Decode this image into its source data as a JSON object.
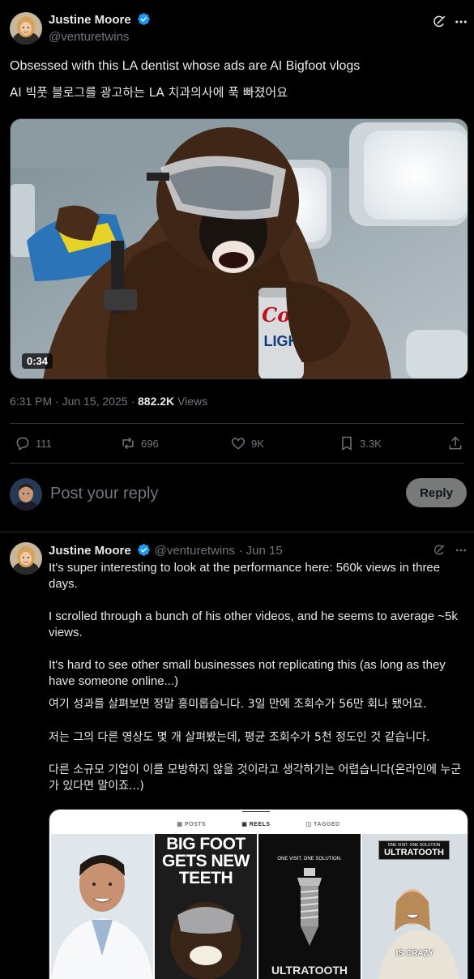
{
  "tweet": {
    "author_name": "Justine Moore",
    "author_handle": "@venturetwins",
    "text_en": "Obsessed with this LA dentist whose ads are AI Bigfoot vlogs",
    "text_ko": "AI 빅풋 블로그를 광고하는 LA 치과의사에 푹 빠졌어요",
    "video_duration": "0:34",
    "can_text": "Cor",
    "can_text2": "LIGH",
    "timestamp": "6:31 PM · Jun 15, 2025",
    "separator": "·",
    "views_count": "882.2K",
    "views_label": "Views",
    "actions": {
      "replies": "111",
      "reposts": "696",
      "likes": "9K",
      "bookmarks": "3.3K"
    }
  },
  "composer": {
    "placeholder": "Post your reply",
    "reply_button": "Reply"
  },
  "reply": {
    "author_name": "Justine Moore",
    "author_handle": "@venturetwins",
    "date": "· Jun 15",
    "para1": "It's super interesting to look at the performance here: 560k views in three days.",
    "para2": "I scrolled through a bunch of his other videos, and he seems to average ~5k views.",
    "para3": "It's hard to see other small businesses not replicating this (as long as they have someone online...)",
    "ko1": "여기 성과를 살펴보면 정말 흥미롭습니다. 3일 만에 조회수가 56만 회나 됐어요.",
    "ko2": "저는 그의 다른 영상도 몇 개 살펴봤는데, 평균 조회수가 5천 정도인 것 같습니다.",
    "ko3": "다른 소규모 기업이 이를 모방하지 않을 것이라고 생각하기는 어렵습니다(온라인에 누군가 있다면 말이죠...)",
    "embed": {
      "tabs": [
        "POSTS",
        "REELS",
        "TAGGED"
      ],
      "tile2_headline": "BIG FOOT GETS NEW TEETH",
      "tile3_tagline": "ONE VISIT. ONE SOLUTION.",
      "tile3_brand": "ULTRATOOTH",
      "tile4_tagline": "ONE VISIT. ONE SOLUTION",
      "tile4_brand": "ULTRATOOTH",
      "tile4_caption": "IS CRAZY"
    }
  },
  "colors": {
    "background": "#000000",
    "text": "#e7e9ea",
    "muted": "#71767b",
    "verified": "#1d9bf0",
    "divider": "#2f3336"
  }
}
